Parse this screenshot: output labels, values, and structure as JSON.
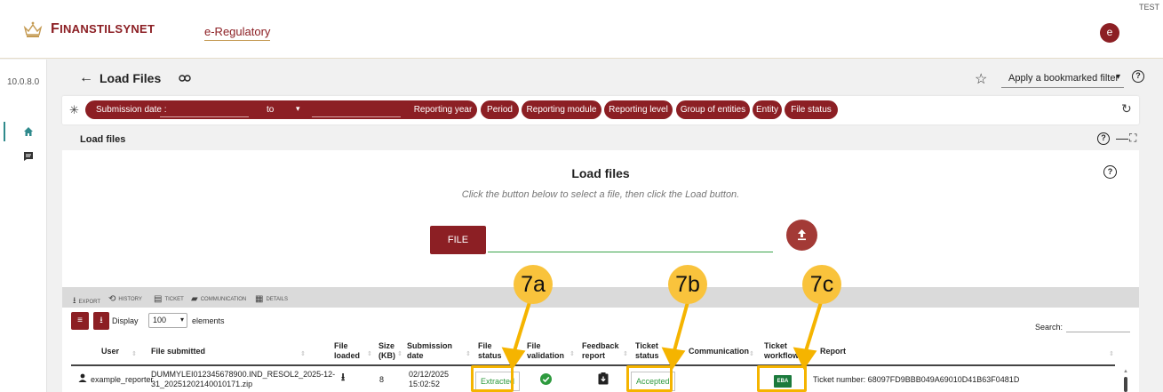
{
  "header": {
    "brand": "Finanstilsynet",
    "brand_first": "F",
    "brand_rest": "INANSTILSYNET",
    "product": "e-Regulatory",
    "env_label": "TEST",
    "avatar_letter": "e"
  },
  "sidebar": {
    "version": "10.0.8.0",
    "items": [
      {
        "icon": "home-icon",
        "active": true
      },
      {
        "icon": "message-icon",
        "active": false
      }
    ]
  },
  "page": {
    "back_glyph": "←",
    "title": "Load Files",
    "link_glyph": "⇔",
    "bookmark_placeholder": "Apply a bookmarked filter",
    "help_glyph": "?"
  },
  "filters": {
    "submission_date_label": "Submission date :",
    "to_label": "to",
    "pills": [
      "Reporting year",
      "Period",
      "Reporting module",
      "Reporting level",
      "Group of entities",
      "Entity",
      "File status"
    ]
  },
  "load_section": {
    "header": "Load files",
    "title": "Load files",
    "instructions": "Click the button below to select a file, then click the Load button.",
    "file_button": "FILE"
  },
  "toolbar": {
    "export": "Export",
    "history": "History",
    "ticket": "Ticket",
    "communication": "Communication",
    "details": "Details"
  },
  "table": {
    "display_label": "Display",
    "page_size": "100",
    "elements_label": "elements",
    "search_label": "Search:",
    "columns": {
      "user": "User",
      "file_submitted": "File submitted",
      "file_loaded_1": "File",
      "file_loaded_2": "loaded",
      "size_1": "Size",
      "size_2": "(KB)",
      "submission_1": "Submission",
      "submission_2": "date",
      "file_status_1": "File",
      "file_status_2": "status",
      "file_validation_1": "File",
      "file_validation_2": "validation",
      "feedback_1": "Feedback",
      "feedback_2": "report",
      "ticket_status_1": "Ticket",
      "ticket_status_2": "status",
      "communication": "Communication",
      "ticket_workflow_1": "Ticket",
      "ticket_workflow_2": "workflow",
      "report": "Report"
    },
    "row": {
      "user": "example_reporter",
      "file_line1": "DUMMYLEI012345678900.IND_RESOL2_2025-12-",
      "file_line2": "31_20251202140010171.zip",
      "size": "8",
      "date_line1": "02/12/2025",
      "date_line2": "15:02:52",
      "file_status": "Extracted",
      "ticket_status": "Accepted",
      "workflow": "EBA",
      "report": "Ticket number: 68097FD9BBB049A69010D41B63F0481D"
    }
  },
  "annotations": {
    "a": "7a",
    "b": "7b",
    "c": "7c",
    "color": "#f5b400"
  },
  "colors": {
    "brand": "#8c1f24",
    "accent_teal": "#2f8a8c",
    "success": "#2e9a3e"
  }
}
